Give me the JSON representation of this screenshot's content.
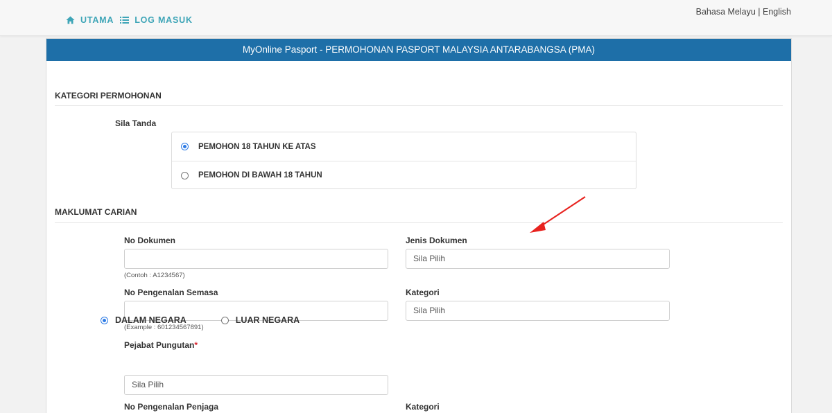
{
  "nav": {
    "home_label": "UTAMA",
    "login_label": "LOG MASUK"
  },
  "lang": {
    "malay": "Bahasa Melayu",
    "separator": " | ",
    "english": "English"
  },
  "panel": {
    "title": "MyOnline Pasport - PERMOHONAN PASPORT MALAYSIA ANTARABANGSA (PMA)"
  },
  "kategori": {
    "title": "KATEGORI PERMOHONAN",
    "instruction": "Sila Tanda",
    "options": [
      {
        "label": "PEMOHON 18 TAHUN KE ATAS",
        "checked": true
      },
      {
        "label": "PEMOHON DI BAWAH 18 TAHUN",
        "checked": false
      }
    ]
  },
  "carian": {
    "title": "MAKLUMAT CARIAN",
    "no_dokumen": {
      "label": "No Dokumen",
      "value": "",
      "hint": "(Contoh : A1234567)"
    },
    "jenis_dokumen": {
      "label": "Jenis Dokumen",
      "value": "Sila Pilih"
    },
    "no_pengenalan": {
      "label": "No Pengenalan Semasa",
      "value": "",
      "hint": "(Example : 601234567891)"
    },
    "kategori": {
      "label": "Kategori",
      "value": "Sila Pilih"
    },
    "pejabat": {
      "label": "Pejabat Pungutan",
      "required_mark": "*",
      "options": [
        {
          "label": "DALAM NEGARA",
          "checked": true
        },
        {
          "label": "LUAR NEGARA",
          "checked": false
        }
      ],
      "value": "Sila Pilih"
    },
    "no_penjaga": {
      "label": "No Pengenalan Penjaga"
    },
    "kategori2": {
      "label": "Kategori"
    }
  },
  "colors": {
    "header_blue": "#1e6fa8",
    "nav_teal": "#3ea5b7",
    "annotation_arrow": "#e8231f"
  }
}
